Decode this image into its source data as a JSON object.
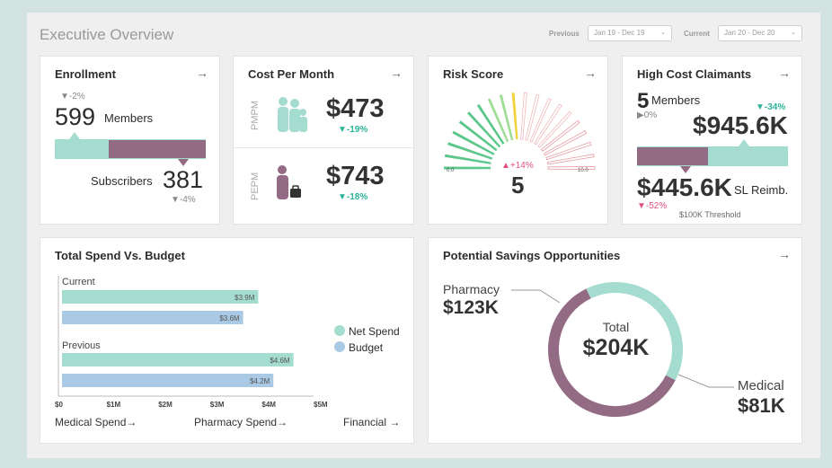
{
  "header": {
    "title": "Executive Overview",
    "previous_label": "Previous",
    "previous_value": "Jan 19 - Dec 19",
    "current_label": "Current",
    "current_value": "Jan 20 - Dec 20",
    "chevron": "chevron-down-icon"
  },
  "enrollment": {
    "title": "Enrollment",
    "members_change": "▼-2%",
    "members_count": "599",
    "members_label": "Members",
    "subscribers_label": "Subscribers",
    "subscribers_count": "381",
    "subscribers_change": "▼-4%",
    "subscriber_ratio": 0.64,
    "colors": {
      "members": "#a4dccf",
      "subscribers": "#946b85"
    }
  },
  "cost_per_month": {
    "title": "Cost Per Month",
    "pmpm_label": "PMPM",
    "pmpm_value": "$473",
    "pmpm_change": "▼-19%",
    "pepm_label": "PEPM",
    "pepm_value": "$743",
    "pepm_change": "▼-18%"
  },
  "risk_score": {
    "title": "Risk Score",
    "min_label": "0.0",
    "max_label": "10.0",
    "change": "▲+14%",
    "value": "5",
    "score": 5,
    "max": 10
  },
  "high_cost": {
    "title": "High Cost Claimants",
    "members_count": "5",
    "members_label": "Members",
    "members_change": "▶0%",
    "amount_change": "▼-34%",
    "amount": "$945.6K",
    "reimb_amount": "$445.6K",
    "reimb_label": "SL Reimb.",
    "reimb_change": "▼-52%",
    "threshold_label": "$100K Threshold",
    "reimb_ratio": 0.47
  },
  "spend_budget": {
    "title": "Total Spend Vs. Budget",
    "current_label": "Current",
    "previous_label": "Previous",
    "legend_net": "Net Spend",
    "legend_budget": "Budget",
    "ticks": [
      "$0",
      "$1M",
      "$2M",
      "$3M",
      "$4M",
      "$5M"
    ],
    "links": [
      "Medical Spend→",
      "Pharmacy Spend→",
      "Financial →"
    ],
    "colors": {
      "net": "#a4dccf",
      "budget": "#a9c9e4"
    }
  },
  "chart_data": {
    "type": "bar",
    "categories": [
      "Current",
      "Previous"
    ],
    "series": [
      {
        "name": "Net Spend",
        "values": [
          3.9,
          4.6
        ],
        "labels": [
          "$3.9M",
          "$4.6M"
        ]
      },
      {
        "name": "Budget",
        "values": [
          3.6,
          4.2
        ],
        "labels": [
          "$3.6M",
          "$4.2M"
        ]
      }
    ],
    "xlim": [
      0,
      5
    ],
    "orientation": "horizontal"
  },
  "savings": {
    "title": "Potential Savings Opportunities",
    "pharmacy_label": "Pharmacy",
    "pharmacy_value": "$123K",
    "pharmacy_amount": 123,
    "total_label": "Total",
    "total_value": "$204K",
    "medical_label": "Medical",
    "medical_value": "$81K",
    "medical_amount": 81,
    "colors": {
      "pharmacy": "#946b85",
      "medical": "#a4dccf"
    }
  },
  "icons": {
    "arrow": "arrow-right-icon"
  },
  "arrow_glyph": "→"
}
